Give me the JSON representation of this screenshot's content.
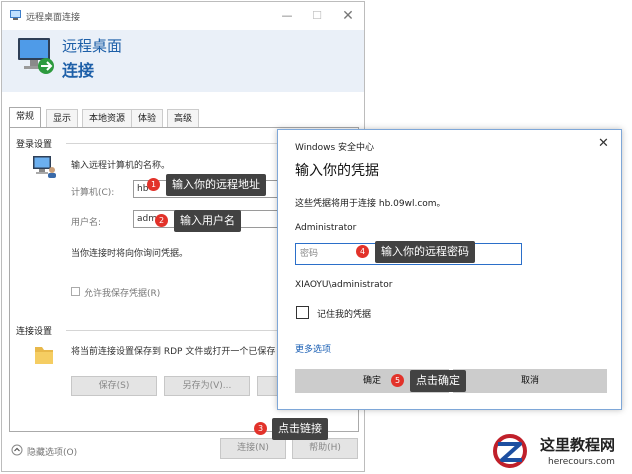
{
  "rdp": {
    "window_title": "远程桌面连接",
    "header_line1": "远程桌面",
    "header_line2": "连接",
    "tabs": [
      {
        "label": "常规"
      },
      {
        "label": "显示"
      },
      {
        "label": "本地资源"
      },
      {
        "label": "体验"
      },
      {
        "label": "高级"
      }
    ],
    "login_section_title": "登录设置",
    "login_instruction": "输入远程计算机的名称。",
    "computer_label": "计算机(C):",
    "computer_value": "hb",
    "username_label": "用户名:",
    "username_value": "adm",
    "credential_note": "当你连接时将向你询问凭据。",
    "save_credentials_label": "允许我保存凭据(R)",
    "connection_section_title": "连接设置",
    "connection_desc": "将当前连接设置保存到 RDP 文件或打开一个已保存",
    "save_button": "保存(S)",
    "save_as_button": "另存为(V)...",
    "hide_options": "隐藏选项(O)",
    "connect_button": "连接(N)",
    "help_button": "帮助(H)"
  },
  "security": {
    "title": "Windows 安全中心",
    "heading": "输入你的凭据",
    "description": "这些凭据将用于连接 hb.09wl.com。",
    "username": "Administrator",
    "password_placeholder": "密码",
    "domain_user": "XIAOYU\\administrator",
    "remember_label": "记住我的凭据",
    "more_options": "更多选项",
    "ok_button": "确定",
    "cancel_button": "取消"
  },
  "callouts": [
    {
      "num": "1",
      "text": "输入你的远程地址"
    },
    {
      "num": "2",
      "text": "输入用户名"
    },
    {
      "num": "3",
      "text": "点击链接"
    },
    {
      "num": "4",
      "text": "输入你的远程密码"
    },
    {
      "num": "5",
      "text": "点击确定"
    }
  ],
  "watermark": {
    "name": "这里教程网",
    "url": "herecours.com"
  },
  "colors": {
    "accent_blue": "#1d5fa8",
    "badge_red": "#e2322a",
    "callout_bg": "#424242"
  }
}
